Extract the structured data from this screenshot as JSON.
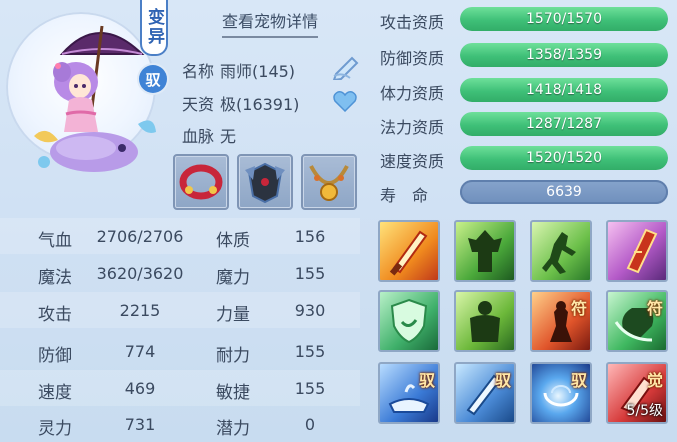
{
  "pet": {
    "detail_link": "查看宠物详情",
    "badge_mutation": "变异",
    "badge_tamed": "驭",
    "name_label": "名称",
    "name_value": "雨师(145)",
    "talent_label": "天资",
    "talent_value": "极(16391)",
    "bloodline_label": "血脉",
    "bloodline_value": "无"
  },
  "stats": [
    {
      "label": "气血",
      "value": "2706/2706",
      "label2": "体质",
      "value2": "156"
    },
    {
      "label": "魔法",
      "value": "3620/3620",
      "label2": "魔力",
      "value2": "155"
    },
    {
      "label": "攻击",
      "value": "2215",
      "label2": "力量",
      "value2": "930"
    },
    {
      "label": "防御",
      "value": "774",
      "label2": "耐力",
      "value2": "155"
    },
    {
      "label": "速度",
      "value": "469",
      "label2": "敏捷",
      "value2": "155"
    },
    {
      "label": "灵力",
      "value": "731",
      "label2": "潜力",
      "value2": "0"
    }
  ],
  "aptitudes": [
    {
      "label": "攻击资质",
      "text": "1570/1570",
      "fill": 1.0
    },
    {
      "label": "防御资质",
      "text": "1358/1359",
      "fill": 0.999
    },
    {
      "label": "体力资质",
      "text": "1418/1418",
      "fill": 1.0
    },
    {
      "label": "法力资质",
      "text": "1287/1287",
      "fill": 1.0
    },
    {
      "label": "速度资质",
      "text": "1520/1520",
      "fill": 1.0
    }
  ],
  "life": {
    "label": "寿　命",
    "value": "6639"
  },
  "skills": [
    {
      "name": "flaming-sword-skill",
      "tag": "",
      "level": ""
    },
    {
      "name": "green-giant-skill",
      "tag": "",
      "level": ""
    },
    {
      "name": "running-warrior-skill",
      "tag": "",
      "level": ""
    },
    {
      "name": "lightning-blade-skill",
      "tag": "",
      "level": ""
    },
    {
      "name": "shield-skill",
      "tag": "",
      "level": ""
    },
    {
      "name": "hulk-skill",
      "tag": "",
      "level": ""
    },
    {
      "name": "fire-warrior-skill",
      "tag": "符",
      "level": ""
    },
    {
      "name": "whirlwind-fist-skill",
      "tag": "符",
      "level": ""
    },
    {
      "name": "water-lamp-skill",
      "tag": "驭",
      "level": ""
    },
    {
      "name": "ice-sword-skill",
      "tag": "驭",
      "level": ""
    },
    {
      "name": "vortex-skill",
      "tag": "驭",
      "level": ""
    },
    {
      "name": "awakening-skill",
      "tag": "觉",
      "level": "5/5级"
    }
  ],
  "colors": {
    "aptitude_fill": "#3fc078",
    "life_bar": "#6f8fbc",
    "badge_blue": "#3f83d6"
  }
}
